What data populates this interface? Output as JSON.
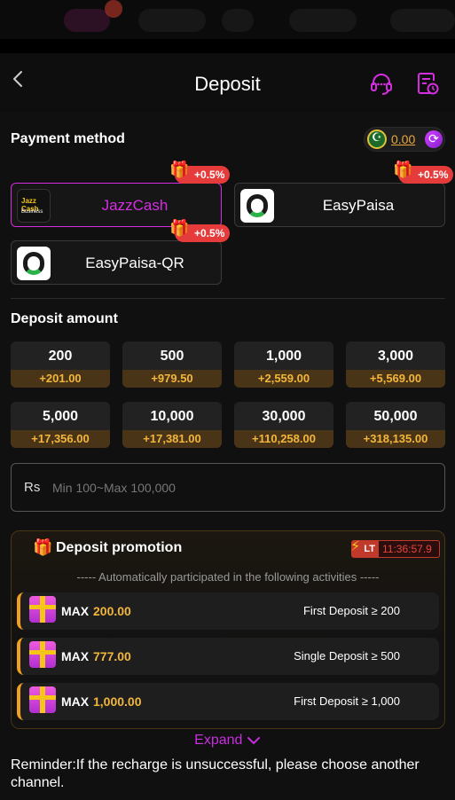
{
  "header": {
    "title": "Deposit"
  },
  "payment": {
    "section_title": "Payment method",
    "balance": "0.00",
    "methods": [
      {
        "label": "JazzCash",
        "bonus": "+0.5%",
        "logo_line1": "Jazz Cash",
        "logo_line2": "Business",
        "selected": true
      },
      {
        "label": "EasyPaisa",
        "bonus": "+0.5%",
        "selected": false
      },
      {
        "label": "EasyPaisa-QR",
        "bonus": "+0.5%",
        "selected": false
      }
    ]
  },
  "deposit": {
    "section_title": "Deposit amount",
    "amounts": [
      {
        "value": "200",
        "bonus": "+201.00"
      },
      {
        "value": "500",
        "bonus": "+979.50"
      },
      {
        "value": "1,000",
        "bonus": "+2,559.00"
      },
      {
        "value": "3,000",
        "bonus": "+5,569.00"
      },
      {
        "value": "5,000",
        "bonus": "+17,356.00"
      },
      {
        "value": "10,000",
        "bonus": "+17,381.00"
      },
      {
        "value": "30,000",
        "bonus": "+110,258.00"
      },
      {
        "value": "50,000",
        "bonus": "+318,135.00"
      }
    ],
    "currency": "Rs",
    "placeholder": "Min 100~Max 100,000"
  },
  "promotion": {
    "title": "Deposit promotion",
    "badge": "LT",
    "timer": "11:36:57.9",
    "subtitle": "----- Automatically participated in the following activities -----",
    "rows": [
      {
        "max_label": "MAX",
        "max_value": "200.00",
        "condition": "First Deposit ≥ 200"
      },
      {
        "max_label": "MAX",
        "max_value": "777.00",
        "condition": "Single Deposit ≥ 500"
      },
      {
        "max_label": "MAX",
        "max_value": "1,000.00",
        "condition": "First Deposit ≥ 1,000"
      }
    ],
    "expand": "Expand"
  },
  "reminder": "Reminder:If the recharge is unsuccessful, please choose another channel.",
  "colors": {
    "accent": "#d42ee0",
    "gold": "#f2b63a",
    "danger": "#e63b3b"
  }
}
